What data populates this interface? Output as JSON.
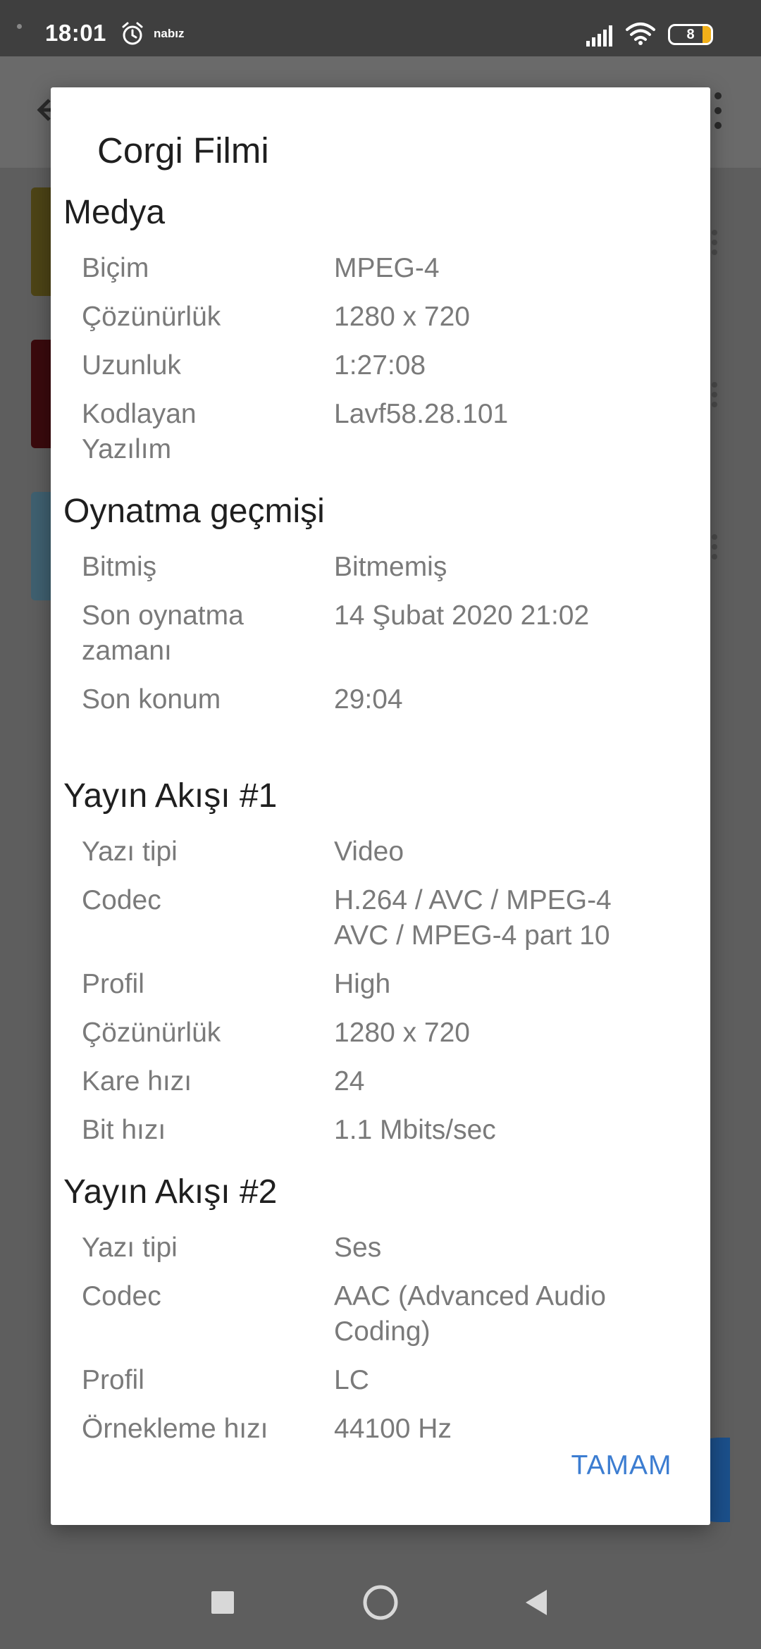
{
  "status_bar": {
    "time": "18:01",
    "app_label": "nabız",
    "battery_level": "8",
    "icons": [
      "alarm-icon",
      "signal-icon",
      "wifi-icon",
      "battery-icon"
    ]
  },
  "dialog": {
    "title": "Corgi Filmi",
    "ok_label": "TAMAM",
    "sections": [
      {
        "title": "Medya",
        "rows": [
          {
            "label": "Biçim",
            "value": "MPEG-4"
          },
          {
            "label": "Çözünürlük",
            "value": "1280 x 720"
          },
          {
            "label": "Uzunluk",
            "value": "1:27:08"
          },
          {
            "label": "Kodlayan Yazılım",
            "value": "Lavf58.28.101"
          }
        ]
      },
      {
        "title": "Oynatma geçmişi",
        "rows": [
          {
            "label": "Bitmiş",
            "value": "Bitmemiş"
          },
          {
            "label": "Son oynatma zamanı",
            "value": "14 Şubat 2020 21:02"
          },
          {
            "label": "Son konum",
            "value": "29:04"
          }
        ]
      },
      {
        "title": "Yayın Akışı #1",
        "rows": [
          {
            "label": "Yazı tipi",
            "value": "Video"
          },
          {
            "label": "Codec",
            "value": "H.264 / AVC / MPEG-4 AVC / MPEG-4 part 10"
          },
          {
            "label": "Profil",
            "value": "High"
          },
          {
            "label": "Çözünürlük",
            "value": "1280 x 720"
          },
          {
            "label": "Kare hızı",
            "value": "24"
          },
          {
            "label": "Bit hızı",
            "value": "1.1 Mbits/sec"
          }
        ]
      },
      {
        "title": "Yayın Akışı #2",
        "rows": [
          {
            "label": "Yazı tipi",
            "value": "Ses"
          },
          {
            "label": "Codec",
            "value": "AAC (Advanced Audio Coding)"
          },
          {
            "label": "Profil",
            "value": "LC"
          },
          {
            "label": "Örnekleme hızı",
            "value": "44100 Hz"
          }
        ]
      }
    ]
  },
  "colors": {
    "accent": "#3c7dd1",
    "scrim": "#5e5e5e",
    "status_bar": "#3f3f3f",
    "battery": "#f2b019"
  }
}
